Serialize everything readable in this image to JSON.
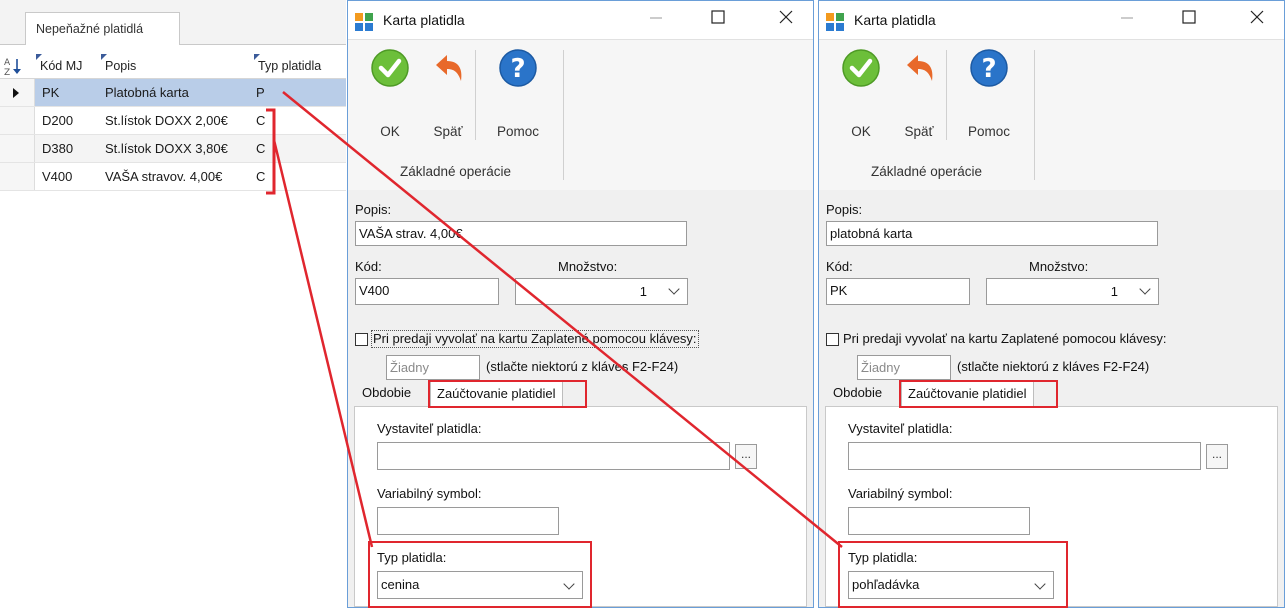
{
  "grid": {
    "tab_label": "Nepeňažné platidlá",
    "sort_icon": "sort-az-icon",
    "columns": [
      "Kód MJ",
      "Popis",
      "Typ platidla"
    ],
    "rows": [
      {
        "kod": "PK",
        "popis": "Platobná karta",
        "typ": "P"
      },
      {
        "kod": "D200",
        "popis": "St.lístok DOXX 2,00€",
        "typ": "C"
      },
      {
        "kod": "D380",
        "popis": "St.lístok DOXX 3,80€",
        "typ": "C"
      },
      {
        "kod": "V400",
        "popis": "VAŠA stravov. 4,00€",
        "typ": "C"
      }
    ]
  },
  "dialogs": [
    {
      "title": "Karta platidla",
      "ribbon": {
        "ok": "OK",
        "back": "Späť",
        "help": "Pomoc",
        "group": "Základné operácie"
      },
      "popis_label": "Popis:",
      "popis_value": "VAŠA strav. 4,00€",
      "kod_label": "Kód:",
      "kod_value": "V400",
      "mnozstvo_label": "Množstvo:",
      "mnozstvo_value": "1",
      "checkbox_label": "Pri predaji vyvolať na kartu Zaplatené pomocou klávesy:",
      "key_value": "Žiadny",
      "key_hint": "(stlačte niektorú z kláves F2-F24)",
      "tabs": [
        "Obdobie",
        "Zaúčtovanie platidiel"
      ],
      "vystavitel_label": "Vystaviteľ platidla:",
      "vystavitel_value": "",
      "ellipsis": "...",
      "vs_label": "Variabilný symbol:",
      "vs_value": "",
      "typ_label": "Typ platidla:",
      "typ_value": "cenina"
    },
    {
      "title": "Karta platidla",
      "ribbon": {
        "ok": "OK",
        "back": "Späť",
        "help": "Pomoc",
        "group": "Základné operácie"
      },
      "popis_label": "Popis:",
      "popis_value": "platobná karta",
      "kod_label": "Kód:",
      "kod_value": "PK",
      "mnozstvo_label": "Množstvo:",
      "mnozstvo_value": "1",
      "checkbox_label": "Pri predaji vyvolať na kartu Zaplatené pomocou klávesy:",
      "key_value": "Žiadny",
      "key_hint": "(stlačte niektorú z kláves F2-F24)",
      "tabs": [
        "Obdobie",
        "Zaúčtovanie platidiel"
      ],
      "vystavitel_label": "Vystaviteľ platidla:",
      "vystavitel_value": "",
      "ellipsis": "...",
      "vs_label": "Variabilný symbol:",
      "vs_value": "",
      "typ_label": "Typ platidla:",
      "typ_value": "pohľadávka"
    }
  ],
  "colors": {
    "accent": "#6a9ed8",
    "highlight": "#e0262e",
    "selected_row": "#b9cde8"
  }
}
